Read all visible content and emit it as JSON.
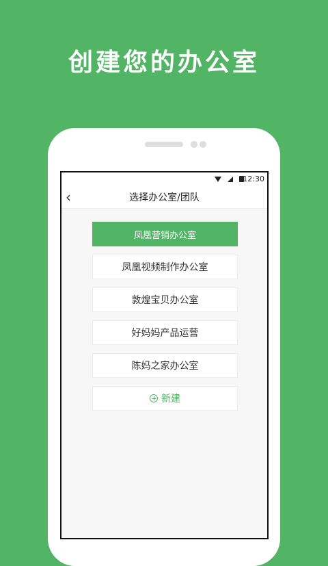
{
  "promo": {
    "headline": "创建您的办公室"
  },
  "status_bar": {
    "time": "12:30"
  },
  "nav": {
    "back_icon": "chevron-left-icon",
    "title": "选择办公室/团队"
  },
  "offices": [
    {
      "label": "凤凰营销办公室",
      "selected": true
    },
    {
      "label": "凤凰视频制作办公室",
      "selected": false
    },
    {
      "label": "敦煌宝贝办公室",
      "selected": false
    },
    {
      "label": "好妈妈产品运营",
      "selected": false
    },
    {
      "label": "陈妈之家办公室",
      "selected": false
    }
  ],
  "new_button": {
    "label": "新建",
    "icon": "plus-circle-icon"
  },
  "colors": {
    "brand_green": "#52b465",
    "background": "#f7f7f7"
  }
}
